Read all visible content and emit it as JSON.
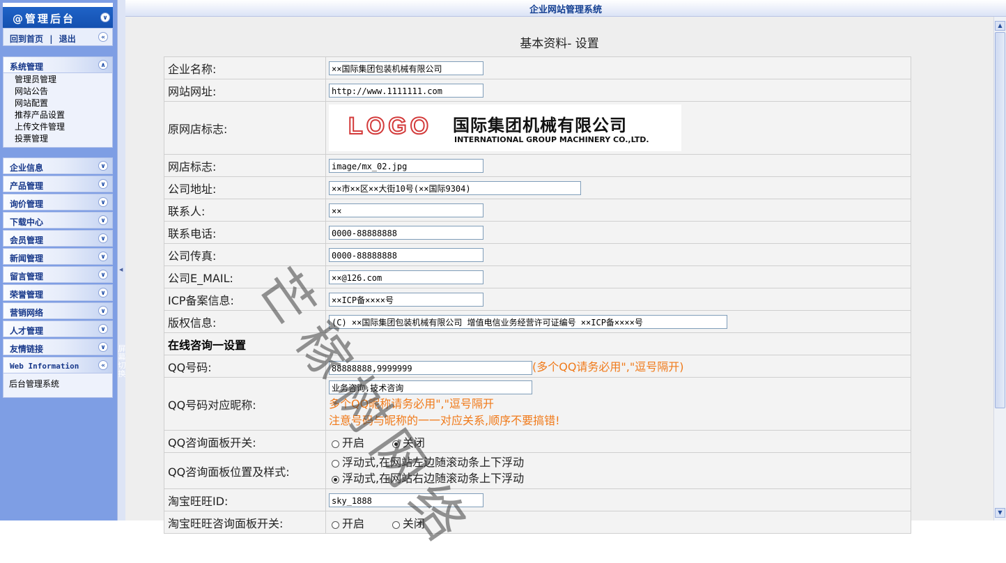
{
  "app": {
    "title": "企业网站管理系统"
  },
  "sidebar": {
    "admin_title": "@管理后台",
    "home_link": "回到首页",
    "separator": "|",
    "logout_link": "退出",
    "system_group": {
      "label": "系统管理",
      "items": [
        "管理员管理",
        "网站公告",
        "网站配置",
        "推荐产品设置",
        "上传文件管理",
        "投票管理"
      ]
    },
    "groups": [
      "企业信息",
      "产品管理",
      "询价管理",
      "下载中心",
      "会员管理",
      "新闻管理",
      "留言管理",
      "荣誉管理",
      "营销网络",
      "人才管理",
      "友情链接"
    ],
    "web_info": {
      "label": "Web Information",
      "text": "后台管理系统"
    },
    "switch_label": "屏幕切换"
  },
  "page": {
    "title": "基本资料- 设置"
  },
  "logo": {
    "big": "LOGO",
    "cn": "国际集团机械有限公司",
    "en": "INTERNATIONAL GROUP MACHINERY CO.,LTD."
  },
  "form": {
    "company_name": {
      "label": "企业名称:",
      "value": "××国际集团包装机械有限公司"
    },
    "site_url": {
      "label": "网站网址:",
      "value": "http://www.1111111.com"
    },
    "orig_logo": {
      "label": "原网店标志:"
    },
    "shop_logo": {
      "label": "网店标志:",
      "value": "image/mx_02.jpg"
    },
    "address": {
      "label": "公司地址:",
      "value": "××市××区××大街10号(××国际9304)"
    },
    "contact": {
      "label": "联系人:",
      "value": "××"
    },
    "phone": {
      "label": "联系电话:",
      "value": "0000-88888888"
    },
    "fax": {
      "label": "公司传真:",
      "value": "0000-88888888"
    },
    "email": {
      "label": "公司E_MAIL:",
      "value": "××@126.com"
    },
    "icp": {
      "label": "ICP备案信息:",
      "value": "××ICP备××××号"
    },
    "copyright": {
      "label": "版权信息:",
      "value": "(C) ××国际集团包装机械有限公司  增值电信业务经营许可证编号 ××ICP备××××号"
    },
    "section_online": "在线咨询一设置",
    "qq": {
      "label": "QQ号码:",
      "value": "88888888,9999999",
      "hint": "(多个QQ请务必用\",\"逗号隔开)"
    },
    "qq_nick": {
      "label": "QQ号码对应昵称:",
      "value": "业务咨询,技术咨询",
      "hint1": "多个QQ昵称请务必用\",\"逗号隔开",
      "hint2": "注意号码与昵称的一一对应关系,顺序不要搞错!"
    },
    "qq_switch": {
      "label": "QQ咨询面板开关:",
      "on": "开启",
      "off": "关闭",
      "selected": "关闭"
    },
    "qq_pos": {
      "label": "QQ咨询面板位置及样式:",
      "opt1": "浮动式,在网站左边随滚动条上下浮动",
      "opt2": "浮动式,在网站右边随滚动条上下浮动",
      "selected": "opt2"
    },
    "wangwang": {
      "label": "淘宝旺旺ID:",
      "value": "sky_1888"
    },
    "wangwang_switch": {
      "label": "淘宝旺旺咨询面板开关:",
      "on": "开启",
      "off": "关闭"
    }
  },
  "watermark": "芒稼树网络",
  "colors": {
    "sidebar_bg": "#7e9ee4",
    "header_blue": "#1450b0",
    "hint_orange": "#f07a1a",
    "title_blue": "#123e91"
  }
}
